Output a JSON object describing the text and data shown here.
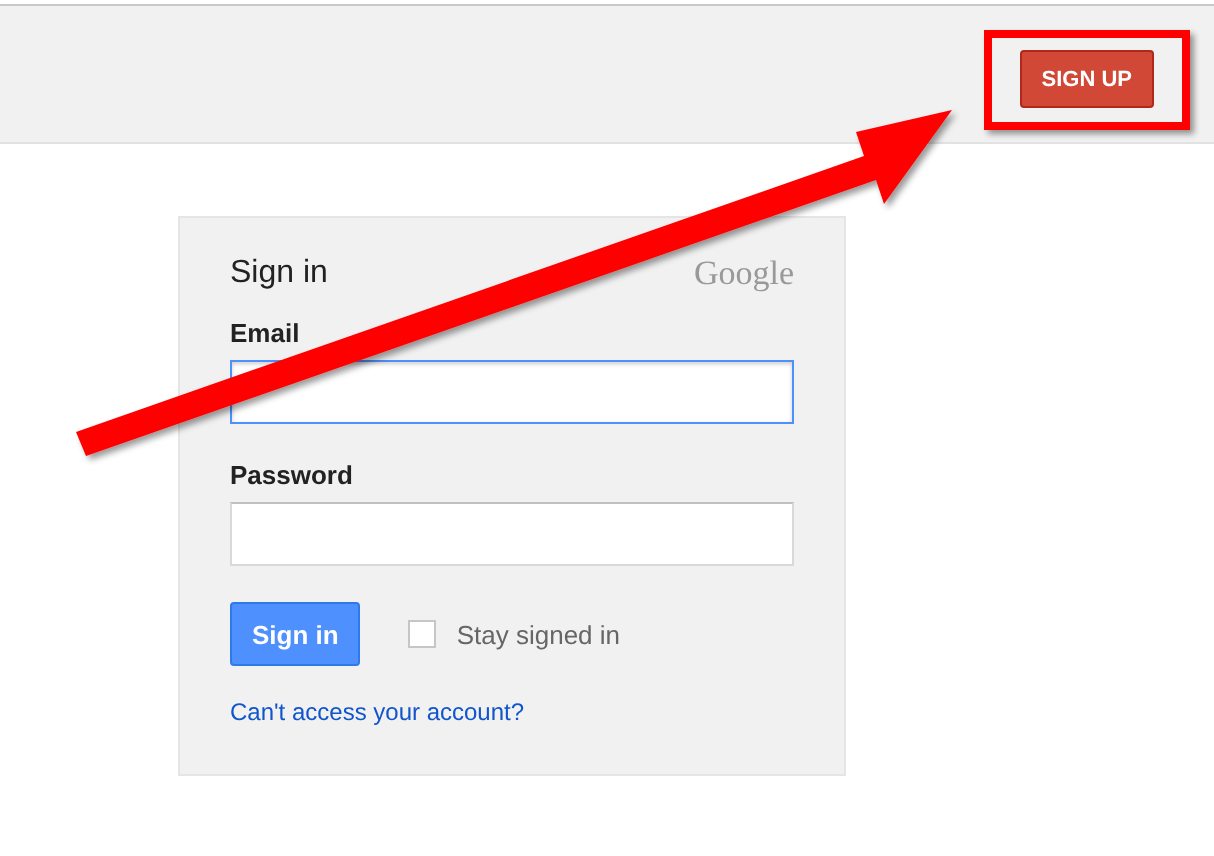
{
  "header": {
    "signup_button": "SIGN UP",
    "highlighted": true
  },
  "signin_card": {
    "title": "Sign in",
    "logo": "Google",
    "fields": [
      {
        "label": "Email",
        "focused": true
      },
      {
        "label": "Password",
        "focused": false
      }
    ],
    "submit_button": "Sign in",
    "stay_signed_in": {
      "label": "Stay signed in",
      "checked": false
    },
    "help_link": "Can't access your account?"
  },
  "annotation": {
    "kind": "arrow"
  }
}
